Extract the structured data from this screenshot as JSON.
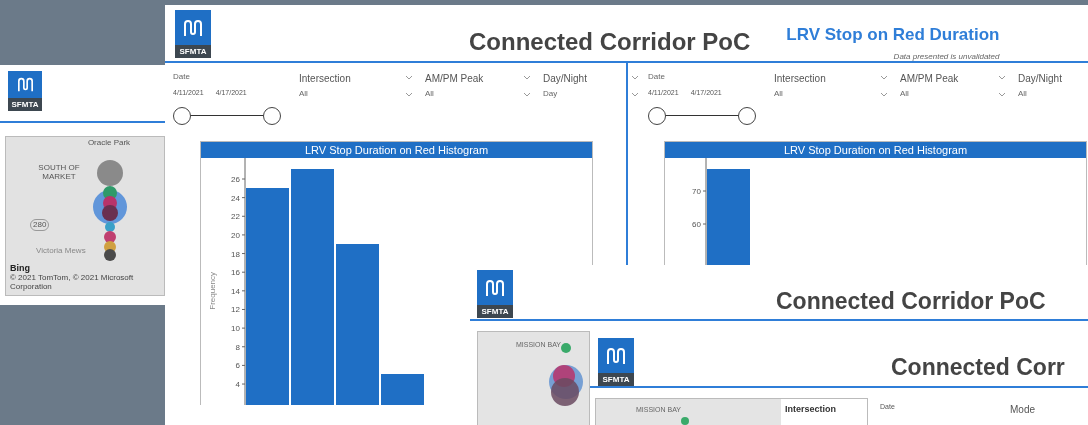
{
  "background_page": {
    "logo_text": "SFMTA",
    "map": {
      "labels": [
        "Oracle Park",
        "SOUTH OF MARKET",
        "280",
        "Victoria Mews"
      ],
      "attribution_logo": "Bing",
      "attribution": "© 2021 TomTom, © 2021 Microsoft Corporation"
    }
  },
  "main_page": {
    "logo_text": "SFMTA",
    "title": "Connected Corridor PoC",
    "subtitle": "LRV Stop on Red Duration",
    "note": "Data presented is unvalidated",
    "panels": [
      {
        "filters": [
          {
            "kind": "date",
            "label": "Date",
            "from": "4/11/2021",
            "to": "4/17/2021",
            "level": 1
          },
          {
            "kind": "dropdown",
            "label": "Intersection",
            "value": "All"
          },
          {
            "kind": "dropdown",
            "label": "AM/PM Peak",
            "value": "All"
          },
          {
            "kind": "dropdown",
            "label": "Day/Night",
            "value": "Day"
          }
        ],
        "chart_title": "LRV Stop Duration on Red Histogram",
        "histogram": {
          "y_axis_title": "Frequency",
          "y_tick_labels": [
            "26",
            "24",
            "22",
            "20",
            "18",
            "16",
            "14",
            "12",
            "10",
            "8",
            "6",
            "4"
          ]
        }
      },
      {
        "filters": [
          {
            "kind": "date",
            "label": "Date",
            "from": "4/11/2021",
            "to": "4/17/2021",
            "level": 1
          },
          {
            "kind": "dropdown",
            "label": "Intersection",
            "value": "All"
          },
          {
            "kind": "dropdown",
            "label": "AM/PM Peak",
            "value": "All"
          },
          {
            "kind": "dropdown",
            "label": "Day/Night",
            "value": "All"
          }
        ],
        "chart_title": "LRV Stop Duration on Red Histogram",
        "histogram": {
          "y_tick_labels": [
            "70",
            "60"
          ]
        }
      }
    ]
  },
  "overlay_page": {
    "logo_text": "SFMTA",
    "title": "Connected Corridor PoC",
    "map_label": "MISSION BAY"
  },
  "front_page": {
    "logo_text": "SFMTA",
    "title": "Connected Corr",
    "map_label": "MISSION BAY",
    "legend_title": "Intersection",
    "filters": [
      "Date",
      "Mode"
    ]
  }
}
